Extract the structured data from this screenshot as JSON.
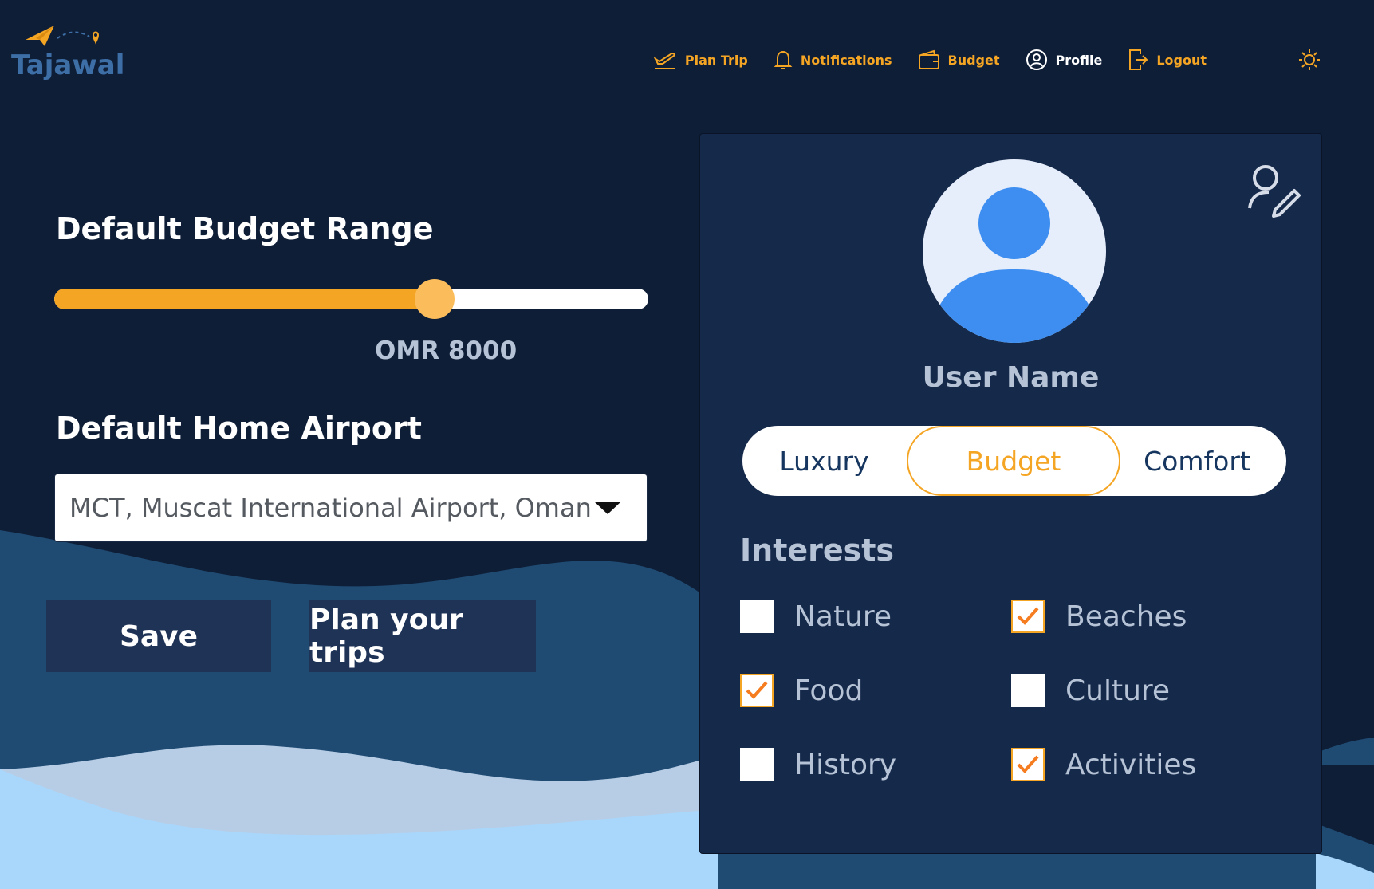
{
  "brand": {
    "name": "Tajawal"
  },
  "nav": {
    "items": [
      {
        "label": "Plan Trip",
        "icon": "plan-trip-icon"
      },
      {
        "label": "Notifications",
        "icon": "bell-icon"
      },
      {
        "label": "Budget",
        "icon": "wallet-icon"
      },
      {
        "label": "Profile",
        "icon": "user-circle-icon"
      },
      {
        "label": "Logout",
        "icon": "logout-icon"
      }
    ],
    "theme_icon": "sun-icon"
  },
  "budget": {
    "title": "Default Budget Range",
    "value_label": "OMR 8000",
    "slider_fraction": 0.64
  },
  "airport": {
    "title": "Default Home Airport",
    "selected": "MCT, Muscat International Airport, Oman"
  },
  "actions": {
    "save": "Save",
    "plan": "Plan your trips"
  },
  "profile": {
    "user_name": "User Name",
    "travel_styles": [
      "Luxury",
      "Budget",
      "Comfort"
    ],
    "selected_style": "Budget",
    "interests_title": "Interests",
    "interests": [
      {
        "label": "Nature",
        "checked": false
      },
      {
        "label": "Beaches",
        "checked": true
      },
      {
        "label": "Food",
        "checked": true
      },
      {
        "label": "Culture",
        "checked": false
      },
      {
        "label": "History",
        "checked": false
      },
      {
        "label": "Activities",
        "checked": true
      }
    ]
  },
  "colors": {
    "background": "#0e1e37",
    "card": "#15294a",
    "accent": "#f5a524",
    "muted_text": "#b6c3d6",
    "button": "#1e3356"
  }
}
